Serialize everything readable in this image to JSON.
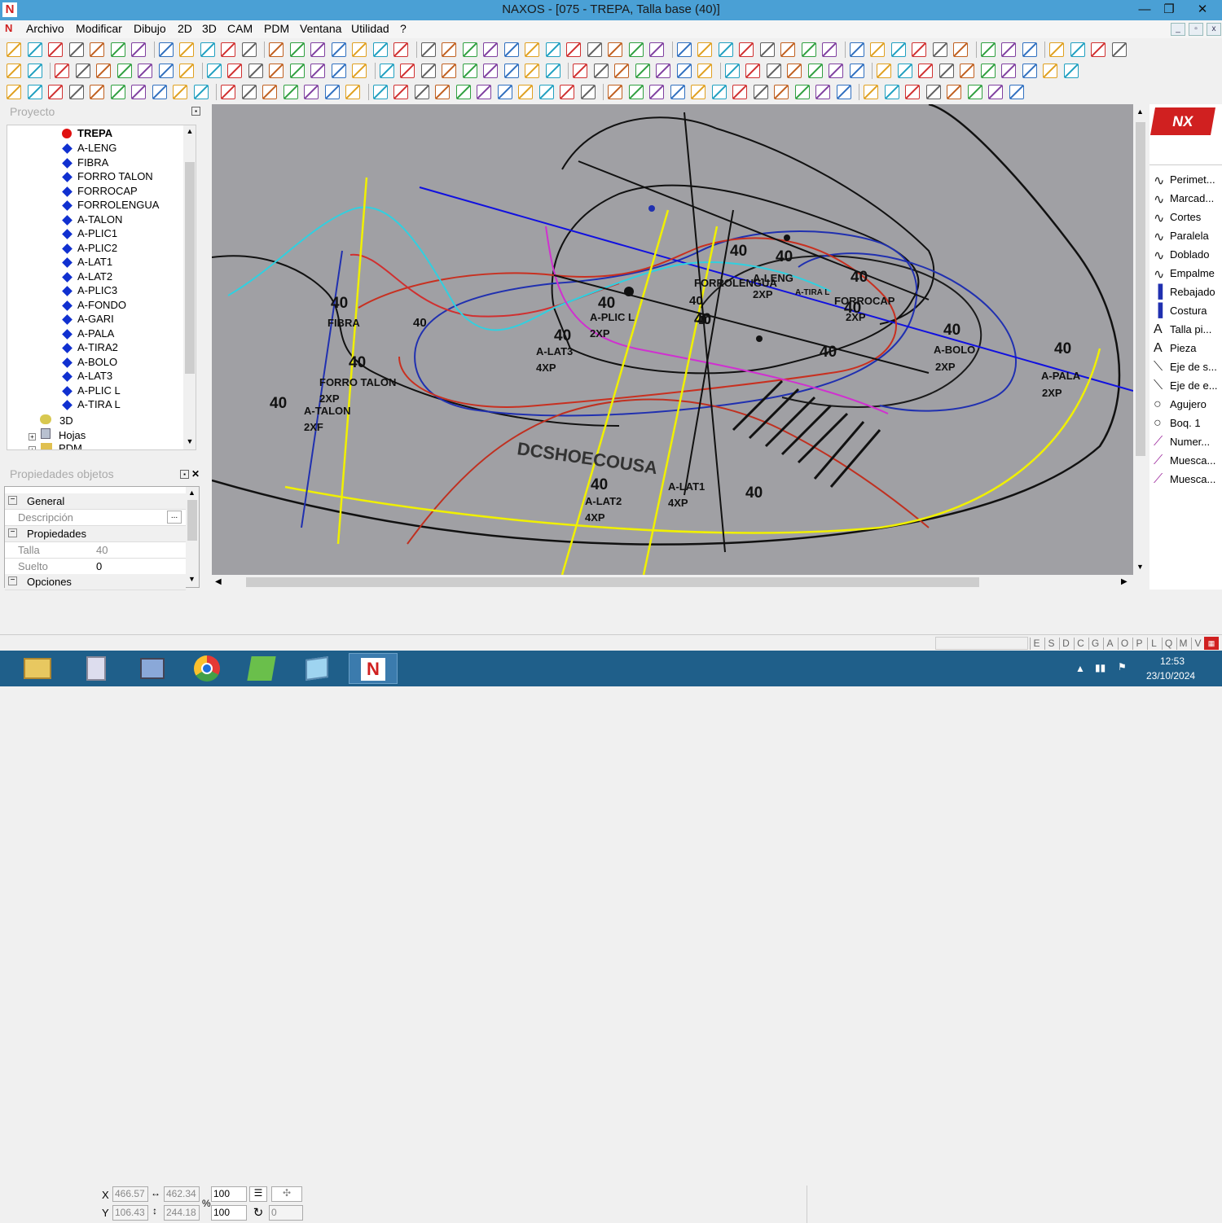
{
  "window": {
    "title": "NAXOS - [075 - TREPA, Talla base (40)]",
    "minimize": "—",
    "maximize": "❐",
    "close": "✕"
  },
  "menu": [
    "Archivo",
    "Modificar",
    "Dibujo",
    "2D",
    "3D",
    "CAM",
    "PDM",
    "Ventana",
    "Utilidad",
    "?"
  ],
  "project": {
    "header": "Proyecto",
    "root": "TREPA",
    "items": [
      "A-LENG",
      "FIBRA",
      "FORRO TALON",
      "FORROCAP",
      "FORROLENGUA",
      "A-TALON",
      "A-PLIC1",
      "A-PLIC2",
      "A-LAT1",
      "A-LAT2",
      "A-PLIC3",
      "A-FONDO",
      "A-GARI",
      "A-PALA",
      "A-TIRA2",
      "A-BOLO",
      "A-LAT3",
      "A-PLIC L",
      "A-TIRA L"
    ],
    "extra": [
      "3D",
      "Hojas",
      "PDM"
    ]
  },
  "properties": {
    "header": "Propiedades objetos",
    "general": "General",
    "descripcion_label": "Descripción",
    "descripcion_btn": "...",
    "propiedades": "Propiedades",
    "talla_label": "Talla",
    "talla_value": "40",
    "suelto_label": "Suelto",
    "suelto_value": "0",
    "opciones": "Opciones"
  },
  "right_panel": {
    "items": [
      {
        "icon": "curve-icon",
        "label": "Perimet..."
      },
      {
        "icon": "curve-icon",
        "label": "Marcad..."
      },
      {
        "icon": "curve-icon",
        "label": "Cortes"
      },
      {
        "icon": "curve-icon",
        "label": "Paralela"
      },
      {
        "icon": "curve-icon",
        "label": "Doblado"
      },
      {
        "icon": "curve-icon",
        "label": "Empalme"
      },
      {
        "icon": "seam-icon",
        "label": "Rebajado"
      },
      {
        "icon": "seam-icon",
        "label": "Costura"
      },
      {
        "icon": "text-icon",
        "label": "Talla pi..."
      },
      {
        "icon": "text-icon",
        "label": "Pieza"
      },
      {
        "icon": "axis-icon",
        "label": "Eje de s..."
      },
      {
        "icon": "axis-icon",
        "label": "Eje de e..."
      },
      {
        "icon": "circle-icon",
        "label": "Agujero"
      },
      {
        "icon": "circle-icon",
        "label": "Boq. 1"
      },
      {
        "icon": "pen-icon",
        "label": "Numer..."
      },
      {
        "icon": "pen-icon",
        "label": "Muesca..."
      },
      {
        "icon": "pen-icon",
        "label": "Muesca..."
      }
    ]
  },
  "coords": {
    "x_label": "X",
    "y_label": "Y",
    "x": "466.57",
    "y": "106.43",
    "w": "462.34",
    "h": "244.18",
    "pct_label": "%",
    "scale_x": "100",
    "scale_y": "100",
    "rot": "0"
  },
  "status_letters": [
    "E",
    "S",
    "D",
    "C",
    "G",
    "A",
    "O",
    "P",
    "L",
    "Q",
    "M",
    "V"
  ],
  "canvas_labels": {
    "sizes": [
      "40",
      "40",
      "40",
      "40",
      "40",
      "40",
      "40",
      "40",
      "40",
      "40",
      "40",
      "40",
      "40",
      "40",
      "40",
      "40",
      "40",
      "40"
    ],
    "pieces": [
      "A-LENG",
      "FORROLENGUA",
      "FORROCAP",
      "A-BOLO",
      "A-PALA",
      "A-PLIC L",
      "A-LAT3",
      "A-TALON",
      "FORRO TALON",
      "FIBRA",
      "A-LAT2",
      "A-LAT1",
      "A-TIRA L"
    ],
    "qty": [
      "2XP",
      "2XP",
      "2XP",
      "2XP",
      "2XP",
      "4XP",
      "2XP",
      "2XF",
      "4XP",
      "4XP"
    ],
    "brand": "DCSHOECOUSA"
  },
  "taskbar": {
    "time": "12:53",
    "date": "23/10/2024"
  }
}
